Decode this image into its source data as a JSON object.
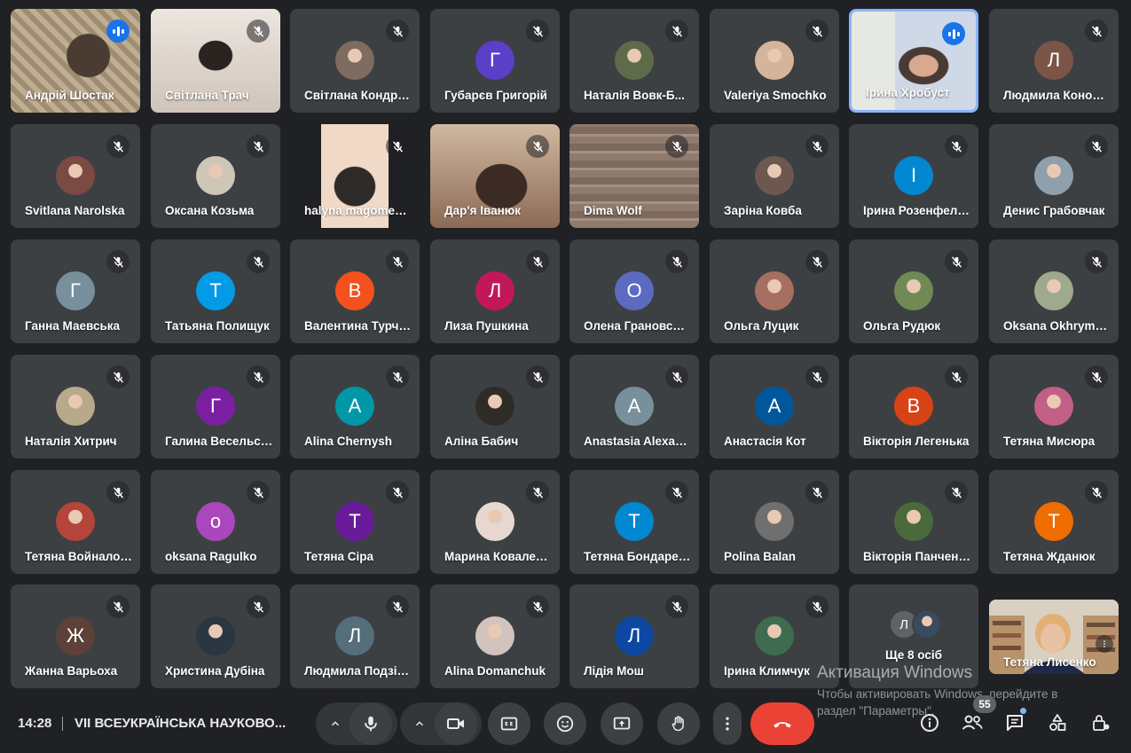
{
  "meeting": {
    "time": "14:28",
    "title": "VII ВСЕУКРАЇНСЬКА НАУКОВО...",
    "people_count": "55"
  },
  "colors": {
    "background": "#202124",
    "tile": "#3c4043",
    "speaking_border": "#8ab4f8",
    "end_call": "#ea4335"
  },
  "participants": [
    {
      "name": "Андрій Шостак",
      "initial": "",
      "color": "#8b7a65",
      "photo": true,
      "speaking": true
    },
    {
      "name": "Світлана Трач",
      "initial": "",
      "color": "#d4c8bf",
      "photo": true
    },
    {
      "name": "Світлана Кондратенко",
      "initial": "",
      "color": "#7f6b5f",
      "photo": true
    },
    {
      "name": "Губарєв Григорій",
      "initial": "Г",
      "color": "#5b3fc8"
    },
    {
      "name": "Наталія Вовк-Б...",
      "initial": "",
      "color": "#5d6b4a",
      "photo": true
    },
    {
      "name": "Valeriya Smochko",
      "initial": "",
      "color": "#d6b49a",
      "photo": true
    },
    {
      "name": "Ірина Хробуст",
      "initial": "",
      "color": "#d9d6cf",
      "photo": true,
      "speaking": true,
      "highlight": true
    },
    {
      "name": "Людмила Коновал",
      "initial": "Л",
      "color": "#7a5548"
    },
    {
      "name": "Svitlana Narolska",
      "initial": "",
      "color": "#7a4a43",
      "photo": true
    },
    {
      "name": "Оксана Козьма",
      "initial": "",
      "color": "#cfc6b8",
      "photo": true
    },
    {
      "name": "halyna magomedova",
      "initial": "",
      "color": "#e8d2c4",
      "photo": true
    },
    {
      "name": "Дар'я Іванюк",
      "initial": "",
      "color": "#a98d74",
      "photo": true
    },
    {
      "name": "Dima Wolf",
      "initial": "",
      "color": "#8e7566",
      "photo": true
    },
    {
      "name": "Заріна Ковба",
      "initial": "",
      "color": "#6d5850",
      "photo": true
    },
    {
      "name": "Ірина Розенфельд",
      "initial": "І",
      "color": "#0288d1"
    },
    {
      "name": "Денис Грабовчак",
      "initial": "",
      "color": "#8fa0ad",
      "photo": true
    },
    {
      "name": "Ганна Маевська",
      "initial": "Г",
      "color": "#78909c"
    },
    {
      "name": "Татьяна Полищук",
      "initial": "Т",
      "color": "#039be5"
    },
    {
      "name": "Валентина Турчин",
      "initial": "В",
      "color": "#f4511e"
    },
    {
      "name": "Лиза Пушкина",
      "initial": "Л",
      "color": "#c2185b"
    },
    {
      "name": "Олена Грановська",
      "initial": "О",
      "color": "#5c6bc0"
    },
    {
      "name": "Ольга Луцик",
      "initial": "",
      "color": "#a66f61",
      "photo": true
    },
    {
      "name": "Ольга Рудюк",
      "initial": "",
      "color": "#6f8a55",
      "photo": true
    },
    {
      "name": "Oksana Okhrymenko",
      "initial": "",
      "color": "#9ea98e",
      "photo": true
    },
    {
      "name": "Наталія Хитрич",
      "initial": "",
      "color": "#b7a98a",
      "photo": true
    },
    {
      "name": "Галина Весельська",
      "initial": "Г",
      "color": "#7b1fa2"
    },
    {
      "name": "Alina Chernysh",
      "initial": "A",
      "color": "#0097a7"
    },
    {
      "name": "Аліна Бабич",
      "initial": "",
      "color": "#2f2b27",
      "photo": true
    },
    {
      "name": "Anastasia Alexandrova",
      "initial": "A",
      "color": "#78909c"
    },
    {
      "name": "Анастасія Кот",
      "initial": "A",
      "color": "#01579b"
    },
    {
      "name": "Вікторія Легенька",
      "initial": "В",
      "color": "#d84315"
    },
    {
      "name": "Тетяна Мисюра",
      "initial": "",
      "color": "#c25f86",
      "photo": true
    },
    {
      "name": "Тетяна Войналович",
      "initial": "",
      "color": "#b5443a",
      "photo": true
    },
    {
      "name": "oksana Ragulko",
      "initial": "o",
      "color": "#ab47bc"
    },
    {
      "name": "Тетяна Сіра",
      "initial": "Т",
      "color": "#6a1b9a"
    },
    {
      "name": "Марина Коваленко",
      "initial": "",
      "color": "#e6d8d0",
      "photo": true
    },
    {
      "name": "Тетяна Бондаренко",
      "initial": "Т",
      "color": "#0288d1"
    },
    {
      "name": "Polina Balan",
      "initial": "",
      "color": "#6f6f6f",
      "photo": true
    },
    {
      "name": "Вікторія Панченко",
      "initial": "",
      "color": "#4a6a3c",
      "photo": true
    },
    {
      "name": "Тетяна Жданюк",
      "initial": "Т",
      "color": "#ef6c00"
    },
    {
      "name": "Жанна Варьоха",
      "initial": "Ж",
      "color": "#5d4037"
    },
    {
      "name": "Христина Дубіна",
      "initial": "",
      "color": "#2b3644",
      "photo": true
    },
    {
      "name": "Людмила Подзігун",
      "initial": "Л",
      "color": "#546e7a"
    },
    {
      "name": "Alina Domanchuk",
      "initial": "",
      "color": "#d3c3bd",
      "photo": true
    },
    {
      "name": "Лідія Мош",
      "initial": "Л",
      "color": "#0d47a1"
    },
    {
      "name": "Ірина Климчук",
      "initial": "",
      "color": "#3f6b4e",
      "photo": true
    }
  ],
  "more_tile": {
    "label": "Ще 8 осіб",
    "initial": "Л"
  },
  "self_view": {
    "name": "Тетяна Лисенко"
  },
  "watermark": {
    "line1": "Активация Windows",
    "line2": "Чтобы активировать Windows, перейдите в",
    "line3": "раздел \"Параметры\"."
  }
}
